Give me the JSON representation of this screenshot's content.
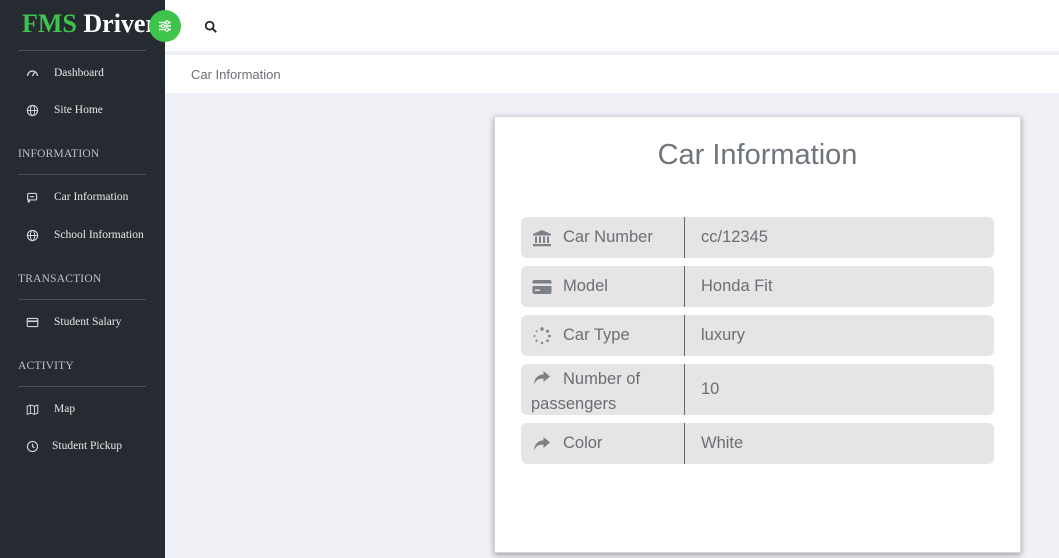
{
  "brand": {
    "part1": "FMS",
    "part2": "Driver"
  },
  "sidebar": {
    "items": [
      {
        "label": "Dashboard"
      },
      {
        "label": "Site Home"
      }
    ],
    "sections": [
      {
        "title": "INFORMATION",
        "items": [
          {
            "label": "Car Information"
          },
          {
            "label": "School Information"
          }
        ]
      },
      {
        "title": "TRANSACTION",
        "items": [
          {
            "label": "Student Salary"
          }
        ]
      },
      {
        "title": "ACTIVITY",
        "items": [
          {
            "label": "Map"
          },
          {
            "label": "Student Pickup"
          }
        ]
      }
    ]
  },
  "breadcrumb": "Car Information",
  "card": {
    "title": "Car Information",
    "rows": [
      {
        "icon": "bank-icon",
        "label": "Car Number",
        "value": "cc/12345"
      },
      {
        "icon": "credit-card-icon",
        "label": "Model",
        "value": "Honda Fit"
      },
      {
        "icon": "spinner-icon",
        "label": "Car Type",
        "value": "luxury"
      },
      {
        "icon": "share-arrow-icon",
        "label": "Number of passengers",
        "value": "10"
      },
      {
        "icon": "share-arrow-icon",
        "label": "Color",
        "value": "White"
      }
    ]
  },
  "colors": {
    "accent": "#3ec44a",
    "sidebar": "#262a31",
    "page": "#eff1f6"
  }
}
